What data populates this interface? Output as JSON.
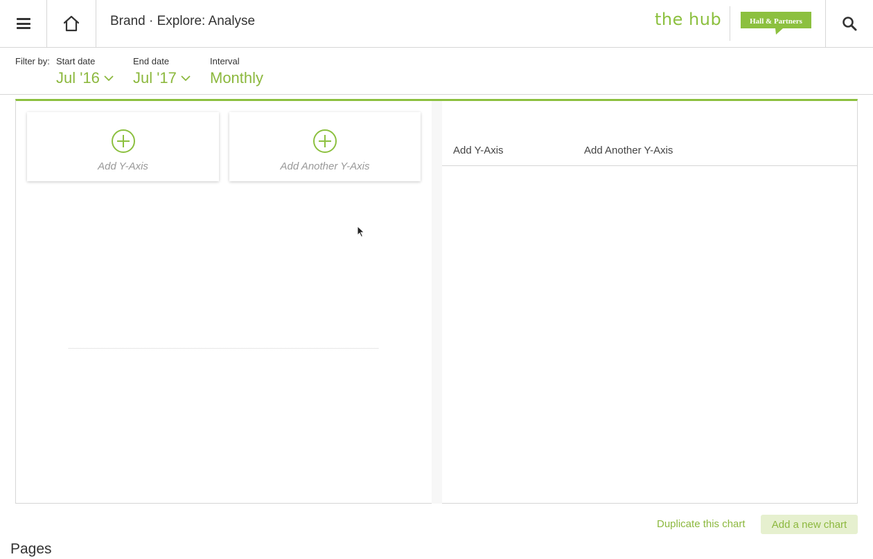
{
  "header": {
    "title": "Brand · Explore: Analyse",
    "logo_text": "the hub",
    "partner_logo_text": "Hall & Partners",
    "icons": {
      "menu": "hamburger-menu-icon",
      "home": "home-icon",
      "search": "search-icon"
    }
  },
  "filters": {
    "label": "Filter by:",
    "start_date": {
      "label": "Start date",
      "value": "Jul '16"
    },
    "end_date": {
      "label": "End date",
      "value": "Jul '17"
    },
    "interval": {
      "label": "Interval",
      "value": "Monthly"
    }
  },
  "chart_builder": {
    "add_y_axis_card": "Add Y-Axis",
    "add_another_y_axis_card": "Add Another Y-Axis",
    "tabs": [
      "Add Y-Axis",
      "Add Another Y-Axis"
    ]
  },
  "actions": {
    "duplicate": "Duplicate this chart",
    "add_new": "Add a new chart"
  },
  "pages": {
    "heading": "Pages"
  },
  "colors": {
    "accent": "#8cc03f",
    "accent_text": "#8cb83e",
    "button_bg": "#e6f0cf",
    "border": "#d6d6d6",
    "text": "#333333"
  }
}
